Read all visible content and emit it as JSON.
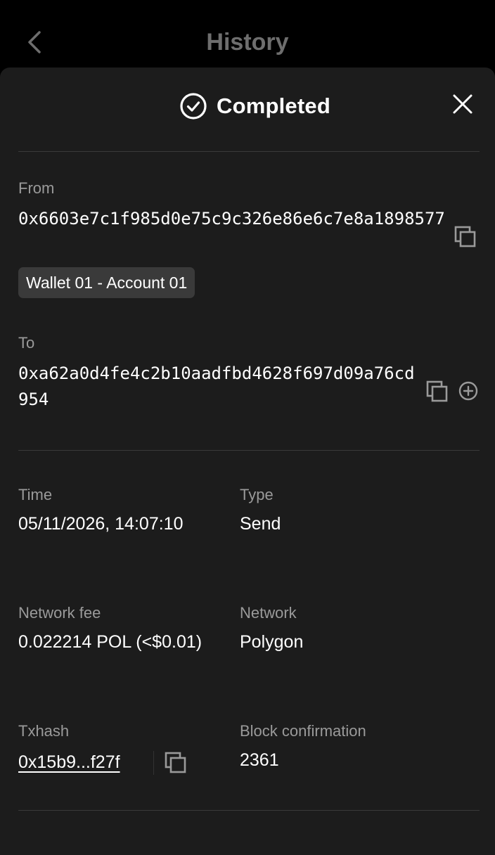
{
  "topbar": {
    "title": "History",
    "back_icon": "chevron-left-icon"
  },
  "status": {
    "label": "Completed",
    "icon": "check-circle-icon",
    "close_icon": "close-icon"
  },
  "from": {
    "label": "From",
    "address": "0x6603e7c1f985d0e75c9c326e86e6c7e8a1898577",
    "account_badge": "Wallet 01 - Account 01",
    "copy_icon": "copy-icon"
  },
  "to": {
    "label": "To",
    "address": "0xa62a0d4fe4c2b10aadfbd4628f697d09a76cd954",
    "copy_icon": "copy-icon",
    "add_icon": "add-contact-icon"
  },
  "details": {
    "time_label": "Time",
    "time_value": "05/11/2026, 14:07:10",
    "type_label": "Type",
    "type_value": "Send",
    "fee_label": "Network fee",
    "fee_value": "0.022214 POL (<$0.01)",
    "network_label": "Network",
    "network_value": "Polygon",
    "txhash_label": "Txhash",
    "txhash_value": "0x15b9...f27f",
    "confirm_label": "Block confirmation",
    "confirm_value": "2361"
  },
  "colors": {
    "background": "#000000",
    "sheet": "#1c1c1c",
    "muted": "#9a9a9a",
    "badge": "#3a3a3a"
  }
}
